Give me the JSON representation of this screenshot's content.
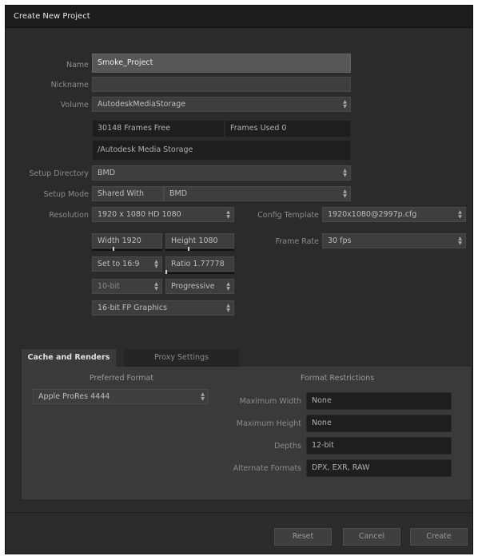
{
  "window": {
    "title": "Create New Project"
  },
  "form": {
    "name_label": "Name",
    "name_value": "Smoke_Project",
    "nickname_label": "Nickname",
    "nickname_value": "",
    "volume_label": "Volume",
    "volume_value": "AutodeskMediaStorage",
    "frames_free": "30148 Frames Free",
    "frames_used": "Frames Used 0",
    "volume_path": "/Autodesk Media Storage",
    "setup_directory_label": "Setup Directory",
    "setup_directory_value": "BMD",
    "setup_mode_label": "Setup Mode",
    "setup_mode_value": "Shared With",
    "setup_mode_target": "BMD",
    "resolution_label": "Resolution",
    "resolution_value": "1920 x 1080 HD 1080",
    "width_label": "Width 1920",
    "height_label": "Height 1080",
    "aspect_value": "Set to 16:9",
    "ratio_label": "Ratio 1.77778",
    "bit_depth_value": "10-bit",
    "scan_value": "Progressive",
    "graphics_value": "16-bit FP Graphics",
    "config_template_label": "Config Template",
    "config_template_value": "1920x1080@2997p.cfg",
    "frame_rate_label": "Frame Rate",
    "frame_rate_value": "30 fps"
  },
  "tabs": [
    {
      "label": "Cache and Renders",
      "active": true
    },
    {
      "label": "Proxy Settings",
      "active": false
    }
  ],
  "cache": {
    "preferred_format_title": "Preferred Format",
    "preferred_format_value": "Apple ProRes 4444",
    "format_restrictions_title": "Format Restrictions",
    "max_width_label": "Maximum Width",
    "max_width_value": "None",
    "max_height_label": "Maximum Height",
    "max_height_value": "None",
    "depths_label": "Depths",
    "depths_value": "12-bit",
    "alternate_formats_label": "Alternate Formats",
    "alternate_formats_value": "DPX, EXR, RAW"
  },
  "buttons": {
    "reset": "Reset",
    "cancel": "Cancel",
    "create": "Create"
  },
  "icons": {
    "spinner": "up-down-arrows-icon",
    "slider_knob": "slider-knob-icon"
  }
}
